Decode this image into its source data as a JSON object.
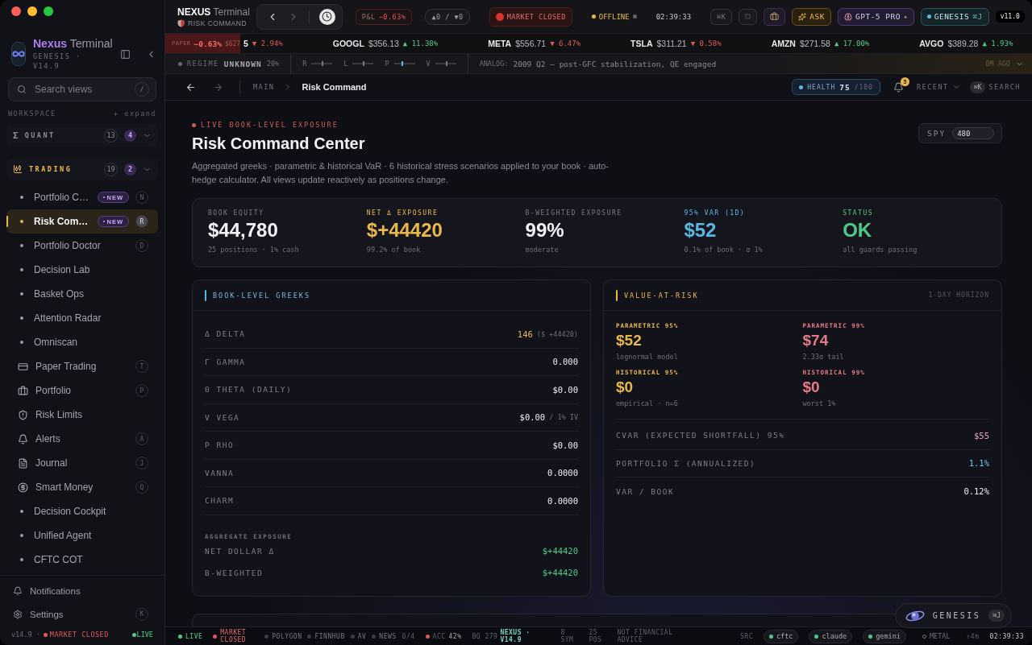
{
  "sidebar": {
    "brand": {
      "name": "Nexus",
      "suffix": "Terminal",
      "subtitle": "GENESIS · V14.9"
    },
    "search": {
      "placeholder": "Search views",
      "shortcut": "/"
    },
    "section": {
      "label": "WORKSPACE",
      "action": "+ expand"
    },
    "groups": [
      {
        "symbol": "Σ",
        "label": "QUANT",
        "total": "13",
        "new": "4",
        "selected": false
      },
      {
        "label": "TRADING",
        "total": "19",
        "new": "2",
        "selected": true,
        "items": [
          {
            "label": "Portfolio C…",
            "kind": "bullet",
            "badge": "NEW",
            "key": "N",
            "selected": false
          },
          {
            "label": "Risk Com…",
            "kind": "bullet",
            "badge": "NEW",
            "key": "R",
            "selected": true
          },
          {
            "label": "Portfolio Doctor",
            "kind": "bullet",
            "key": "D",
            "selected": false
          },
          {
            "label": "Decision Lab",
            "kind": "bullet",
            "selected": false
          },
          {
            "label": "Basket Ops",
            "kind": "bullet",
            "selected": false
          },
          {
            "label": "Attention Radar",
            "kind": "bullet",
            "selected": false
          },
          {
            "label": "Omniscan",
            "kind": "bullet",
            "selected": false
          },
          {
            "label": "Paper Trading",
            "kind": "icon",
            "key": "T",
            "selected": false
          },
          {
            "label": "Portfolio",
            "kind": "icon",
            "key": "P",
            "selected": false
          },
          {
            "label": "Risk Limits",
            "kind": "icon",
            "selected": false
          },
          {
            "label": "Alerts",
            "kind": "icon",
            "key": "A",
            "selected": false
          },
          {
            "label": "Journal",
            "kind": "icon",
            "key": "J",
            "selected": false
          },
          {
            "label": "Smart Money",
            "kind": "icon",
            "key": "Q",
            "selected": false
          },
          {
            "label": "Decision Cockpit",
            "kind": "bullet",
            "selected": false
          },
          {
            "label": "Unified Agent",
            "kind": "bullet",
            "selected": false
          },
          {
            "label": "CFTC COT",
            "kind": "bullet",
            "selected": false
          }
        ]
      }
    ],
    "footer": {
      "items": [
        {
          "label": "Notifications"
        },
        {
          "label": "Settings",
          "key": "K"
        }
      ],
      "version": "v14.9 ·",
      "market": "MARKET CLOSED",
      "live": "LIVE"
    }
  },
  "topbar": {
    "app": "NEXUS",
    "app_suffix": "Terminal",
    "view": "RISK COMMAND",
    "pnl_label": "P&L",
    "pnl": "−0.63%",
    "movers": "▲0 / ▼0",
    "market": "MARKET CLOSED",
    "connection": "OFFLINE",
    "clock": "02:39:33",
    "palette_key": "⌘K",
    "ask": "ASK",
    "model": "GPT-5 PRO",
    "model_star": "★",
    "genesis": "GENESIS",
    "genesis_key": "⌘J",
    "version": "v11.0"
  },
  "ticker": {
    "paper": {
      "label": "PAPER",
      "change": "−0.63%",
      "amount": "$627"
    },
    "items": [
      {
        "price": "5",
        "change": "▼ 2.94%",
        "color": "#e2565a"
      },
      {
        "symbol": "GOOGL",
        "price": "$356.13",
        "change": "▲ 11.38%",
        "color": "#4fc98a"
      },
      {
        "symbol": "META",
        "price": "$556.71",
        "change": "▼ 6.47%",
        "color": "#e2565a"
      },
      {
        "symbol": "TSLA",
        "price": "$311.21",
        "change": "▼ 0.58%",
        "color": "#e2565a"
      },
      {
        "symbol": "AMZN",
        "price": "$271.58",
        "change": "▲ 17.00%",
        "color": "#4fc98a"
      },
      {
        "symbol": "AVGO",
        "price": "$389.28",
        "change": "▲ 1.93%",
        "color": "#4fc98a"
      }
    ]
  },
  "regime": {
    "label": "REGIME",
    "value": "UNKNOWN",
    "confidence": "20%",
    "factors": [
      {
        "label": "R",
        "level": 0.5
      },
      {
        "label": "L",
        "level": 0.5
      },
      {
        "label": "P",
        "level": 0.35
      },
      {
        "label": "V",
        "level": 0.5
      }
    ],
    "analog_label": "ANALOG:",
    "analog": "2009 Q2 — post-GFC stabilization, QE engaged",
    "age": "0M AGO"
  },
  "breadcrumb": {
    "root": "MAIN",
    "current": "Risk Command",
    "health_label": "HEALTH",
    "health": "75",
    "health_max": "/100",
    "alerts": "5",
    "recent": "RECENT",
    "search_key": "⌘K",
    "search": "SEARCH"
  },
  "header": {
    "eyebrow": "LIVE BOOK-LEVEL EXPOSURE",
    "title": "Risk Command Center",
    "description": "Aggregated greeks · parametric & historical VaR · 6 historical stress scenarios applied to your book · auto-hedge calculator. All views update reactively as positions change.",
    "spy": {
      "label": "SPY",
      "value": "480"
    }
  },
  "stats": [
    {
      "label": "BOOK EQUITY",
      "value": "$44,780",
      "note": "25 positions · 1% cash"
    },
    {
      "label": "NET Δ EXPOSURE",
      "value": "$+44420",
      "note": "99.2% of book",
      "color": "#e8b84a"
    },
    {
      "label": "B-WEIGHTED EXPOSURE",
      "value": "99%",
      "note": "moderate"
    },
    {
      "label": "95% VAR (1D)",
      "value": "$52",
      "note": "0.1% of book · σ 1%",
      "color": "#5ab8e0"
    },
    {
      "label": "STATUS",
      "value": "OK",
      "note": "all guards passing",
      "color": "#4fc98a"
    }
  ],
  "greeks": {
    "title": "BOOK-LEVEL GREEKS",
    "rows": [
      {
        "label": "Δ DELTA",
        "value": "146",
        "note": "($ +44420)",
        "color": "#e8b84a"
      },
      {
        "label": "Γ GAMMA",
        "value": "0.000"
      },
      {
        "label": "Θ THETA (DAILY)",
        "value": "$0.00"
      },
      {
        "label": "V VEGA",
        "value": "$0.00",
        "note": "/ 1% IV"
      },
      {
        "label": "P RHO",
        "value": "$0.00"
      },
      {
        "label": "VANNA",
        "value": "0.0000"
      },
      {
        "label": "CHARM",
        "value": "0.0000"
      }
    ],
    "aggregate": {
      "title": "AGGREGATE EXPOSURE",
      "rows": [
        {
          "label": "NET DOLLAR Δ",
          "value": "$+44420"
        },
        {
          "label": "B-WEIGHTED",
          "value": "$+44420"
        }
      ]
    }
  },
  "var": {
    "title": "VALUE-AT-RISK",
    "horizon": "1-DAY HORIZON",
    "metrics": [
      {
        "label": "PARAMETRIC 95%",
        "value": "$52",
        "note": "lognormal model",
        "color": "#e8b84a"
      },
      {
        "label": "PARAMETRIC 99%",
        "value": "$74",
        "note": "2.33σ tail",
        "color": "#e77a8a"
      },
      {
        "label": "HISTORICAL 95%",
        "value": "$0",
        "note": "empirical · n=6",
        "color": "#e8b84a"
      },
      {
        "label": "HISTORICAL 99%",
        "value": "$0",
        "note": "worst 1%",
        "color": "#e77a8a"
      }
    ],
    "rows": [
      {
        "label": "CVAR (EXPECTED SHORTFALL) 95%",
        "value": "$55",
        "color": "#e7a0b6"
      },
      {
        "label": "PORTFOLIO Σ (ANNUALIZED)",
        "value": "1.1%",
        "color": "#6cc6ee"
      },
      {
        "label": "VAR / BOOK",
        "value": "0.12%"
      }
    ]
  },
  "assistant": {
    "label": "GENESIS",
    "key": "⌘J"
  },
  "status": {
    "live": "LIVE",
    "market": "MARKET CLOSED",
    "sources": [
      {
        "label": "POLYGON"
      },
      {
        "label": "FINNHUB"
      },
      {
        "label": "AV"
      },
      {
        "label": "NEWS"
      }
    ],
    "sources_count": "0/4",
    "acc_label": "ACC",
    "acc": "42%",
    "bq": "BQ 279",
    "build": "NEXUS · V14.9",
    "symbols": "8 SYM",
    "positions": "25 POS",
    "disclaimer": "NOT FINANCIAL ADVICE",
    "src_label": "SRC",
    "providers": [
      {
        "label": "cftc",
        "on": true
      },
      {
        "label": "claude",
        "on": true
      },
      {
        "label": "gemini",
        "on": true
      },
      {
        "label": "METAL",
        "on": false
      }
    ],
    "age": "↑4m",
    "clock": "02:39:33"
  }
}
